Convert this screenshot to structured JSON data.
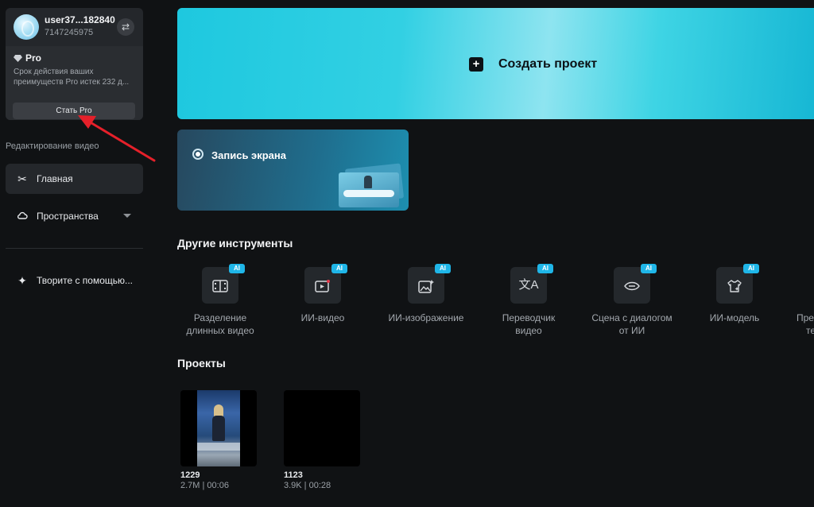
{
  "account": {
    "username": "user37...182840",
    "user_id": "7147245975",
    "pro_title": "Pro",
    "pro_desc_line1": "Срок действия ваших",
    "pro_desc_line2": "преимуществ Pro истек 232 д...",
    "become_pro_label": "Стать Pro"
  },
  "sidebar": {
    "section_label": "Редактирование видео",
    "items": [
      {
        "label": "Главная",
        "icon": "scissors-icon",
        "active": true
      },
      {
        "label": "Пространства",
        "icon": "cloud-icon",
        "active": false
      },
      {
        "label": "Творите с помощью...",
        "icon": "sparkle-icon",
        "active": false
      }
    ]
  },
  "main": {
    "create_label": "Создать проект",
    "record_label": "Запись экрана",
    "tools_title": "Другие инструменты",
    "ai_badge": "AI",
    "tools": [
      {
        "line1": "Разделение",
        "line2": "длинных видео",
        "icon": "split-video-icon"
      },
      {
        "line1": "ИИ-видео",
        "line2": "",
        "icon": "ai-video-icon"
      },
      {
        "line1": "ИИ-изображение",
        "line2": "",
        "icon": "ai-image-icon"
      },
      {
        "line1": "Переводчик",
        "line2": "видео",
        "icon": "translate-icon"
      },
      {
        "line1": "Сцена с диалогом",
        "line2": "от ИИ",
        "icon": "dialog-scene-icon"
      },
      {
        "line1": "ИИ-модель",
        "line2": "",
        "icon": "ai-model-icon"
      },
      {
        "line1": "Пре",
        "line2": "те",
        "icon": "tool-icon"
      }
    ],
    "projects_title": "Проекты",
    "projects": [
      {
        "name": "1229",
        "meta": "2.7M | 00:06"
      },
      {
        "name": "1123",
        "meta": "3.9K | 00:28"
      }
    ]
  },
  "colors": {
    "background": "#101214",
    "card": "#24272b",
    "accent": "#1fb6e8",
    "annotation_arrow": "#e5202a"
  }
}
